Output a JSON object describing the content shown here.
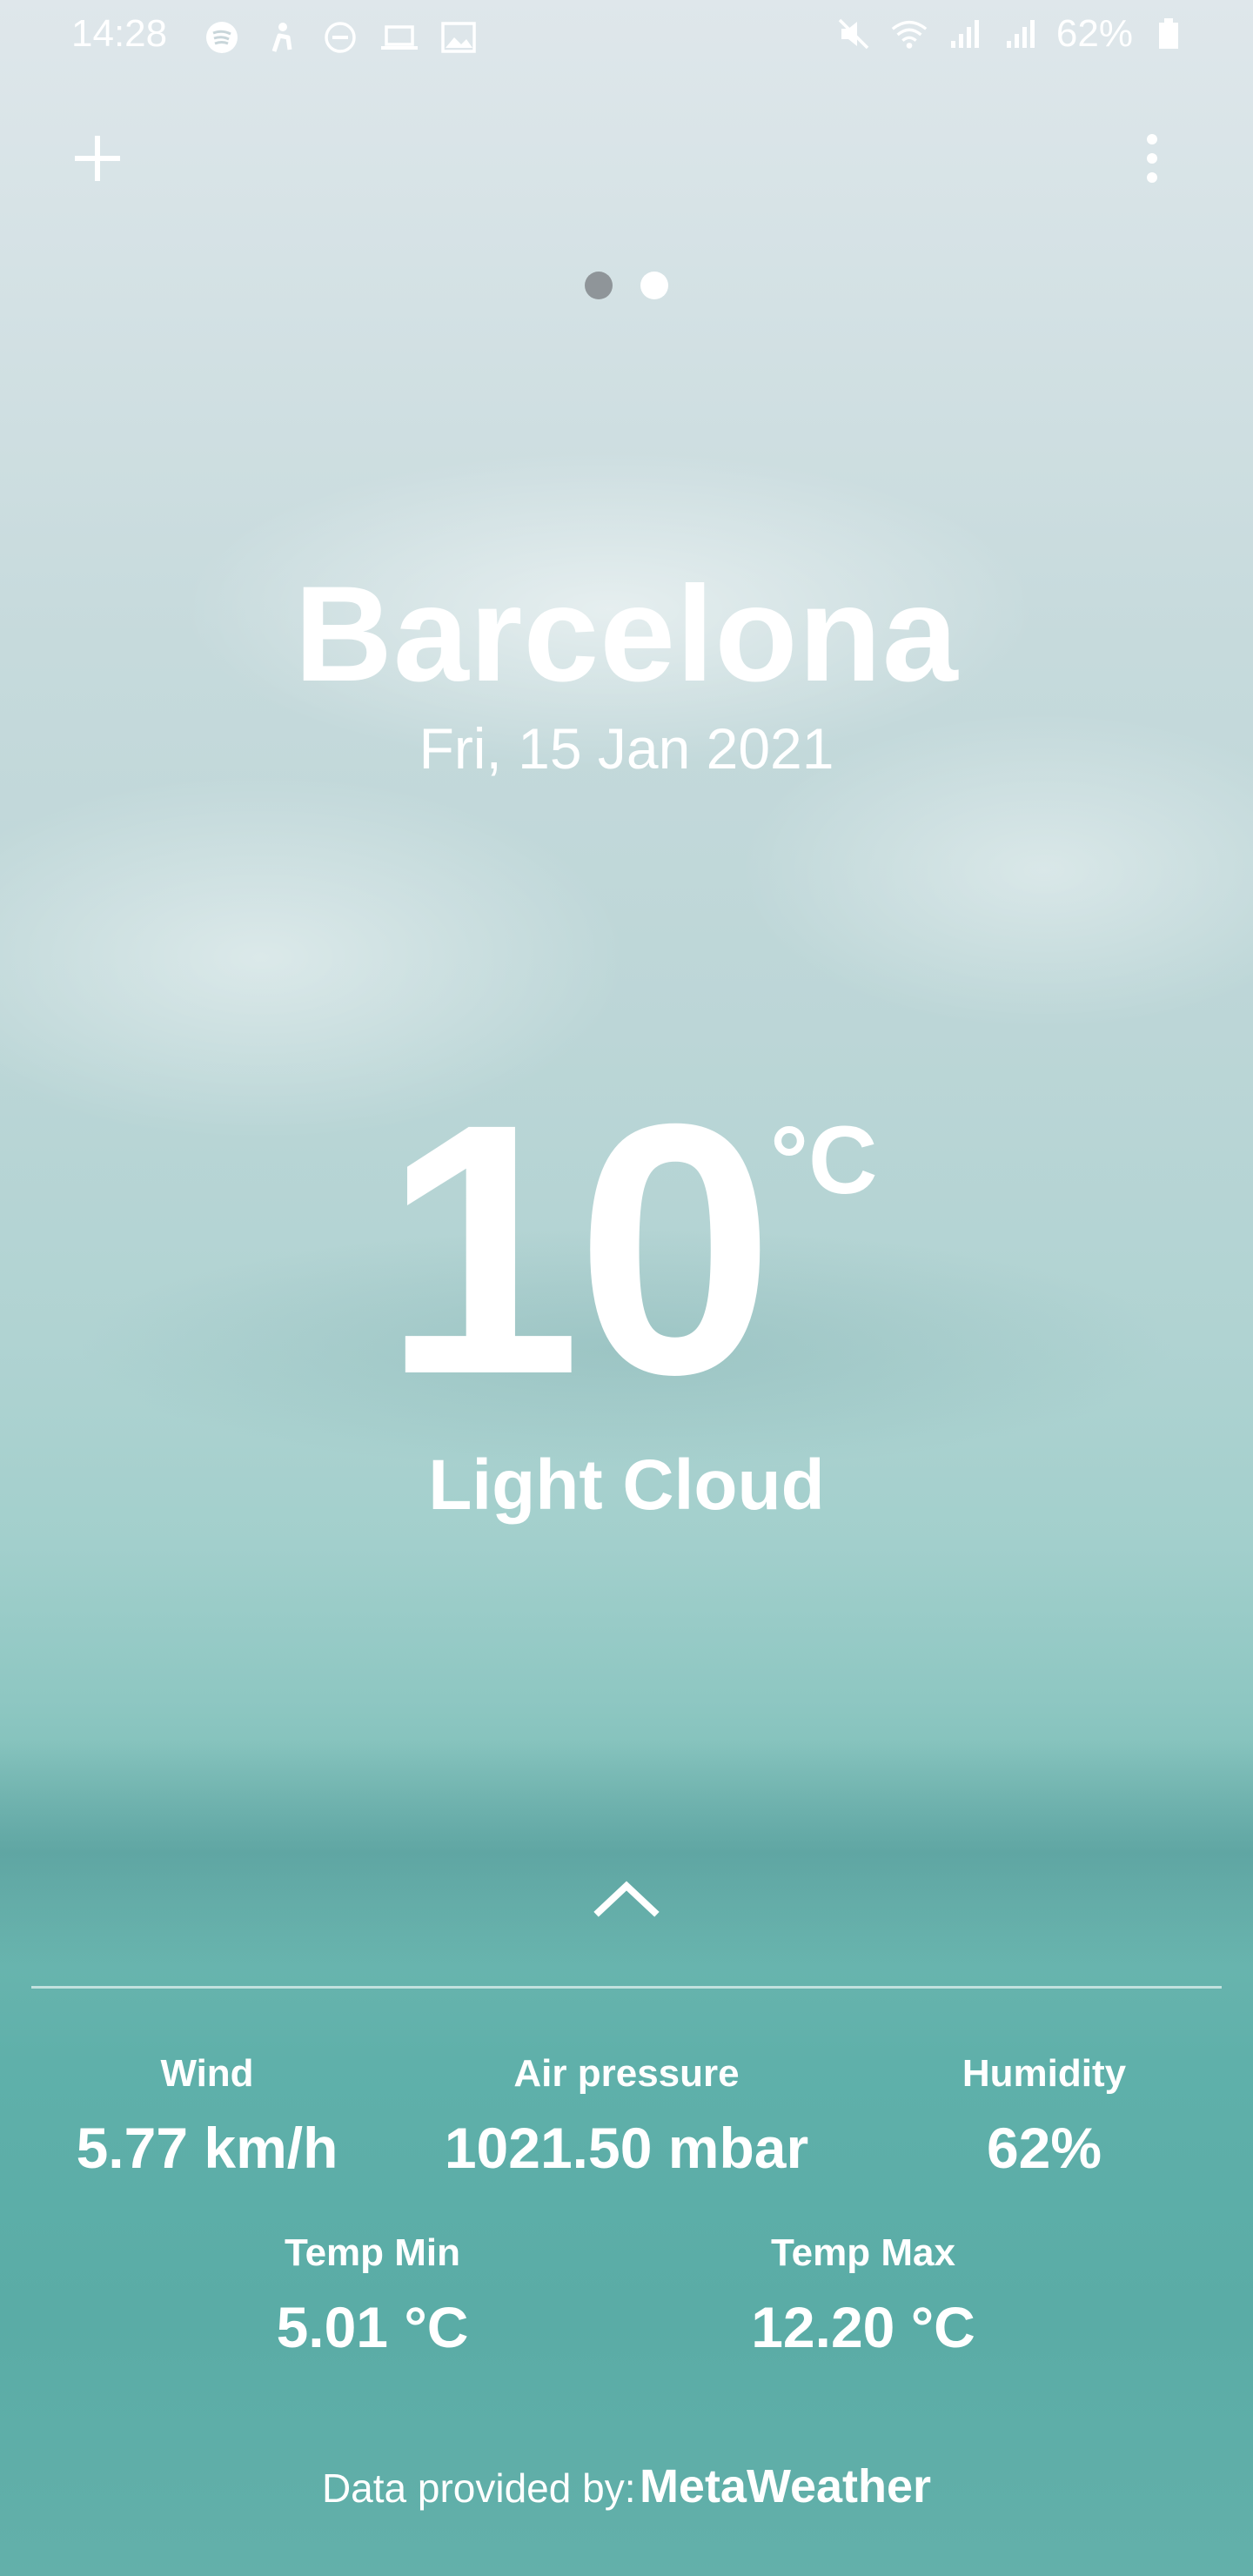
{
  "status_bar": {
    "time": "14:28",
    "left_icons": [
      "spotify-icon",
      "figure-icon",
      "do-not-disturb-icon",
      "laptop-icon",
      "image-icon"
    ],
    "right_icons": [
      "mute-icon",
      "wifi-icon",
      "signal-icon",
      "signal-icon"
    ],
    "battery": "62%"
  },
  "header": {
    "add_icon": "plus-icon",
    "menu_icon": "more-vert-icon",
    "pages": {
      "count": 2,
      "active_index": 0
    }
  },
  "weather": {
    "city": "Barcelona",
    "date": "Fri, 15 Jan 2021",
    "temperature": "10",
    "unit": "°C",
    "condition": "Light Cloud"
  },
  "details": {
    "expand_icon": "chevron-up-icon",
    "wind": {
      "label": "Wind",
      "value": "5.77 km/h"
    },
    "air_pressure": {
      "label": "Air pressure",
      "value": "1021.50 mbar"
    },
    "humidity": {
      "label": "Humidity",
      "value": "62%"
    },
    "temp_min": {
      "label": "Temp Min",
      "value": "5.01 °C"
    },
    "temp_max": {
      "label": "Temp Max",
      "value": "12.20 °C"
    }
  },
  "footer": {
    "prefix": "Data provided by:",
    "source": "MetaWeather"
  },
  "colors": {
    "text": "#ffffff",
    "dot_active": "#8f9599",
    "dot_inactive": "#ffffff",
    "sky_top": "#dfe7eb",
    "sea": "#5aaca6"
  }
}
